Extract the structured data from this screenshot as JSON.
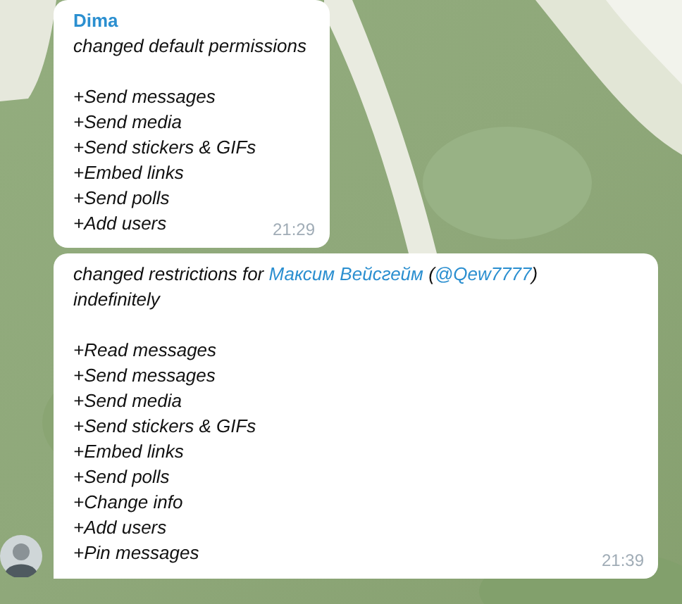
{
  "messages": [
    {
      "sender": "Dima",
      "action": [
        {
          "kind": "plain",
          "text": "changed default permissions"
        }
      ],
      "permissions": [
        "+Send messages",
        "+Send media",
        "+Send stickers & GIFs",
        "+Embed links",
        "+Send polls",
        "+Add users"
      ],
      "time": "21:29",
      "show_avatar": false
    },
    {
      "action": [
        {
          "kind": "plain",
          "text": "changed restrictions for "
        },
        {
          "kind": "link",
          "text": "Максим Вейсгейм"
        },
        {
          "kind": "plain",
          "text": " ("
        },
        {
          "kind": "link",
          "text": "@Qew7777"
        },
        {
          "kind": "plain",
          "text": ")"
        }
      ],
      "detail": "indefinitely",
      "permissions": [
        "+Read messages",
        "+Send messages",
        "+Send media",
        "+Send stickers & GIFs",
        "+Embed links",
        "+Send polls",
        "+Change info",
        "+Add users",
        "+Pin messages"
      ],
      "time": "21:39",
      "show_avatar": true
    }
  ]
}
